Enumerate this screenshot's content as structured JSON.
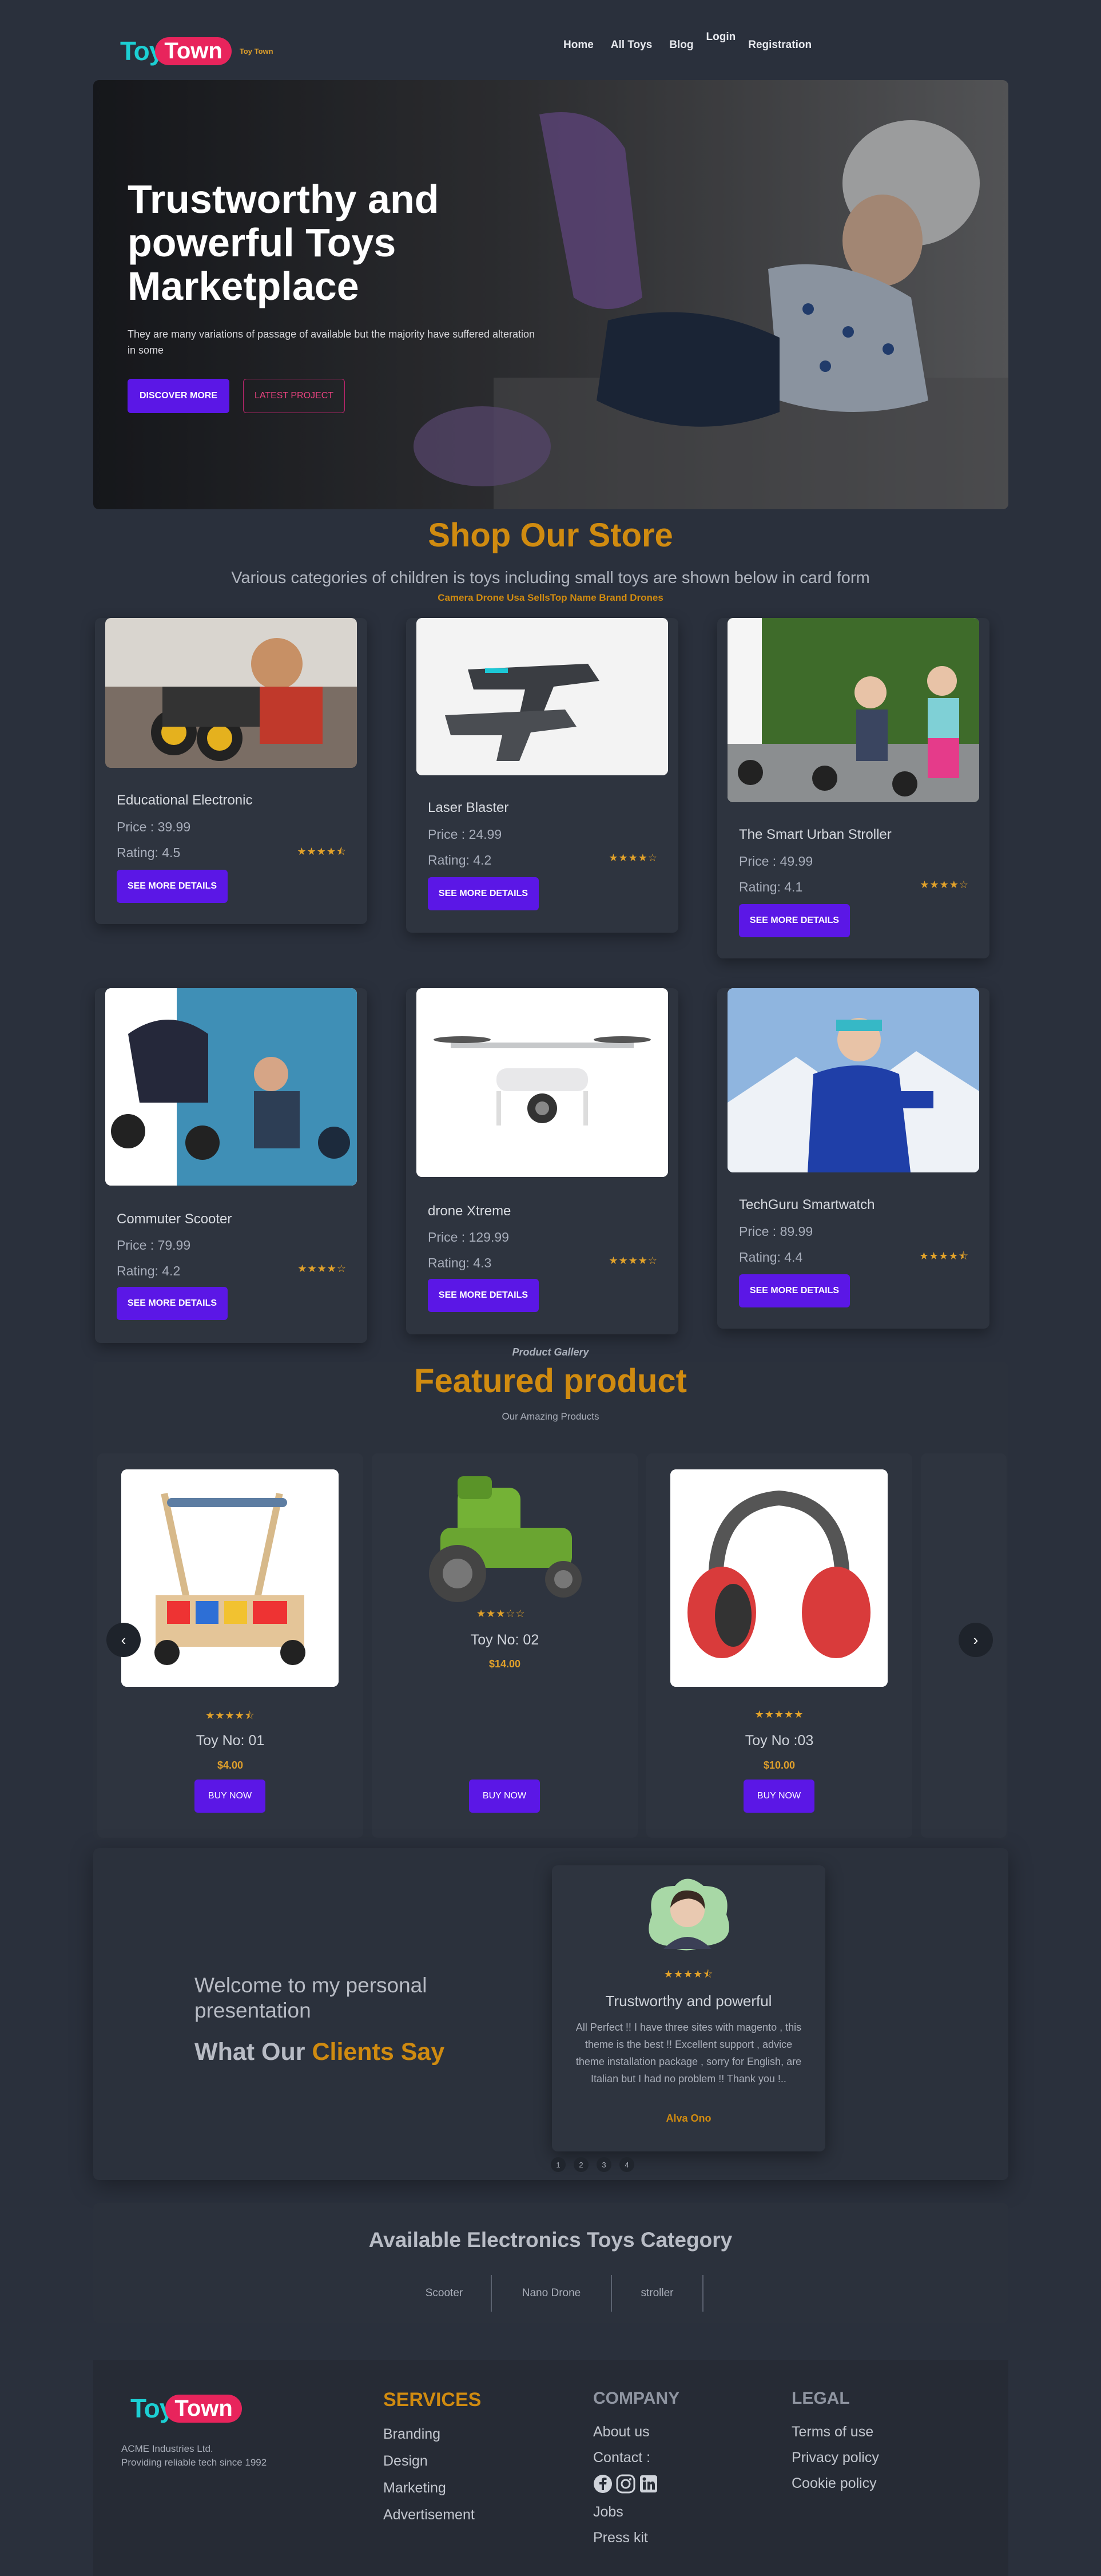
{
  "nav": {
    "logo_toy": "Toy",
    "logo_town": "Town",
    "logo_tag": "Toy Town",
    "links": [
      "Home",
      "All Toys",
      "Blog",
      "Login",
      "Registration"
    ]
  },
  "hero": {
    "title_line1": "Trustworthy and",
    "title_line2": "powerful Toys",
    "title_line3": "Marketplace",
    "subtitle": "They are many variations of passage of available but the majority have suffered alteration in some",
    "btn_primary": "DISCOVER MORE",
    "btn_secondary": "LATEST PROJECT"
  },
  "shop": {
    "title": "Shop Our Store",
    "subtitle": "Various categories of children is toys including small toys are shown below in card form",
    "tagline": "Camera Drone Usa SellsTop Name Brand Drones",
    "details_label": "SEE MORE DETAILS",
    "products": [
      {
        "name": "Educational Electronic",
        "price": "Price : 39.99",
        "rating": "Rating: 4.5",
        "stars": "★★★★⯪"
      },
      {
        "name": "Laser Blaster",
        "price": "Price : 24.99",
        "rating": "Rating: 4.2",
        "stars": "★★★★☆"
      },
      {
        "name": "The Smart Urban Stroller",
        "price": "Price : 49.99",
        "rating": "Rating: 4.1",
        "stars": "★★★★☆"
      },
      {
        "name": "Commuter Scooter",
        "price": "Price : 79.99",
        "rating": "Rating: 4.2",
        "stars": "★★★★☆"
      },
      {
        "name": "drone Xtreme",
        "price": "Price : 129.99",
        "rating": "Rating: 4.3",
        "stars": "★★★★☆"
      },
      {
        "name": "TechGuru Smartwatch",
        "price": "Price : 89.99",
        "rating": "Rating: 4.4",
        "stars": "★★★★⯪"
      }
    ]
  },
  "featured": {
    "kicker": "Product Gallery",
    "title": "Featured product",
    "subtitle": "Our Amazing Products",
    "buy_label": "BUY NOW",
    "prev": "‹",
    "next": "›",
    "items": [
      {
        "name": "Toy No: 01",
        "price": "$4.00",
        "stars": "★★★★⯪"
      },
      {
        "name": "Toy No: 02",
        "price": "$14.00",
        "stars": "★★★☆☆"
      },
      {
        "name": "Toy No :03",
        "price": "$10.00",
        "stars": "★★★★★"
      }
    ]
  },
  "testimonial": {
    "welcome": "Welcome to my personal presentation",
    "what_our": "What Our",
    "clients_say": "Clients Say",
    "stars": "★★★★⯪",
    "heading": "Trustworthy and powerful",
    "text": "All Perfect !! I have three sites with magento , this theme is the best !! Excellent support , advice theme installation package , sorry for English, are Italian but I had no problem !! Thank you !..",
    "author": "Alva Ono",
    "pages": [
      "1",
      "2",
      "3",
      "4"
    ]
  },
  "categories": {
    "title": "Available Electronics Toys Category",
    "tabs": [
      "Scooter",
      "Nano Drone",
      "stroller"
    ]
  },
  "footer": {
    "company_name": "ACME Industries Ltd.",
    "company_tag": "Providing reliable tech since 1992",
    "services_title": "SERVICES",
    "services": [
      "Branding",
      "Design",
      "Marketing",
      "Advertisement"
    ],
    "company_title": "COMPANY",
    "about": "About us",
    "contact": "Contact :",
    "company_links": [
      "Jobs",
      "Press kit"
    ],
    "legal_title": "LEGAL",
    "legal": [
      "Terms of use",
      "Privacy policy",
      "Cookie policy"
    ]
  },
  "colors": {
    "accent": "#d08b10",
    "purple": "#5b17e6",
    "bg": "#2a303c"
  }
}
